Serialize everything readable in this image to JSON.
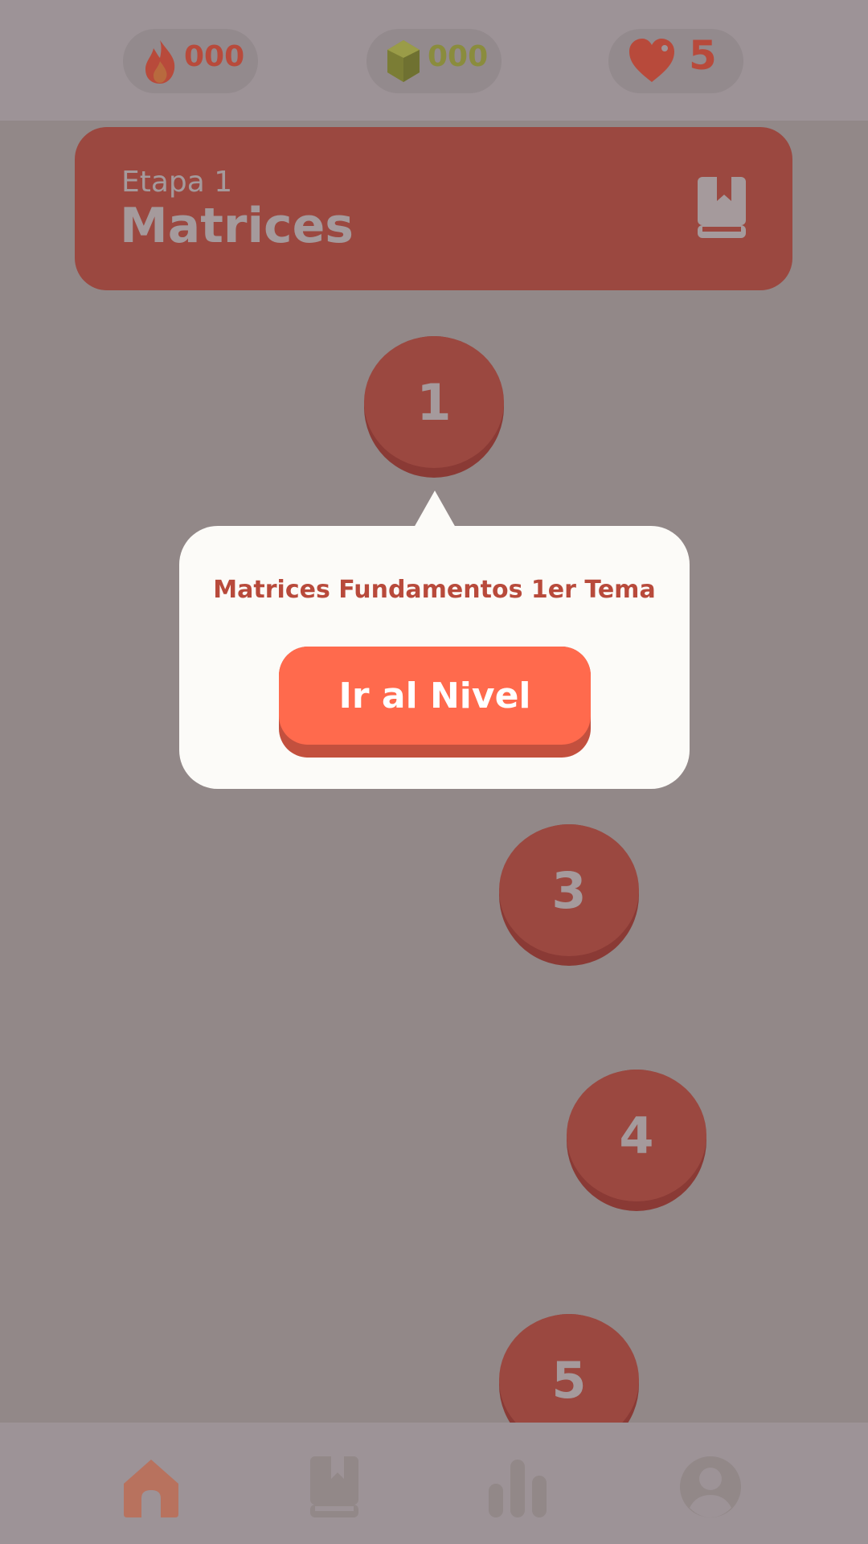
{
  "stats": {
    "streak": {
      "icon": "flame-icon",
      "value": "000",
      "color": "#b84a3b"
    },
    "gems": {
      "icon": "gem-icon",
      "value": "000",
      "color": "#8a8c3d"
    },
    "lives": {
      "icon": "heart-icon",
      "value": "5",
      "color": "#b84a3b"
    }
  },
  "stage": {
    "subtitle": "Etapa 1",
    "title": "Matrices",
    "icon": "book-icon"
  },
  "levels": [
    {
      "label": "1"
    },
    {
      "label": "3"
    },
    {
      "label": "4"
    },
    {
      "label": "5"
    }
  ],
  "popup": {
    "title": "Matrices Fundamentos 1er Tema",
    "button_label": "Ir al Nivel"
  },
  "bottom_nav": [
    {
      "icon": "home-icon",
      "active": true
    },
    {
      "icon": "library-icon",
      "active": false
    },
    {
      "icon": "stats-icon",
      "active": false
    },
    {
      "icon": "profile-icon",
      "active": false
    }
  ],
  "colors": {
    "accent": "#ff6a4d",
    "node": "#9b4840",
    "overlay_bg": "#928888",
    "popup_bg": "#fcfbf8"
  }
}
